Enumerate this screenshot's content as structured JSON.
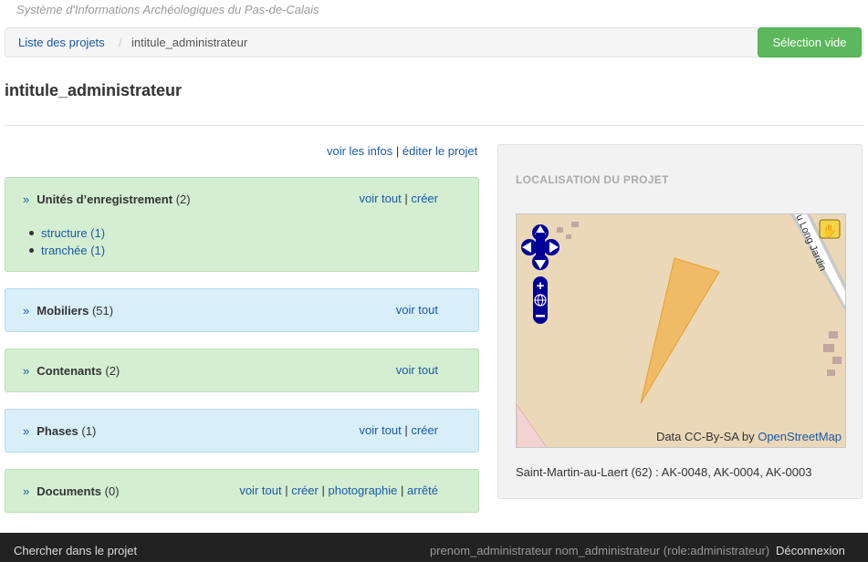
{
  "site": {
    "title": "Système d'Informations Archéologiques du Pas-de-Calais"
  },
  "breadcrumb": {
    "projects_link": "Liste des projets",
    "separator": "/",
    "current": "intitule_administrateur"
  },
  "header": {
    "selection_button": "Sélection vide"
  },
  "page": {
    "title": "intitule_administrateur"
  },
  "project_links": {
    "view_info": "voir les infos",
    "separator": "|",
    "edit": "éditer le projet"
  },
  "panels": {
    "unites": {
      "chevron": "»",
      "title": "Unités d’enregistrement",
      "count": "(2)",
      "view_all": "voir tout",
      "sep": "|",
      "create": "créer",
      "items": [
        {
          "label": "structure (1)"
        },
        {
          "label": "tranchée (1)"
        }
      ]
    },
    "mobiliers": {
      "chevron": "»",
      "title": "Mobiliers",
      "count": "(51)",
      "view_all": "voir tout"
    },
    "contenants": {
      "chevron": "»",
      "title": "Contenants",
      "count": "(2)",
      "view_all": "voir tout"
    },
    "phases": {
      "chevron": "»",
      "title": "Phases",
      "count": "(1)",
      "view_all": "voir tout",
      "sep": "|",
      "create": "créer"
    },
    "documents": {
      "chevron": "»",
      "title": "Documents",
      "count": "(0)",
      "view_all": "voir tout",
      "sep1": "|",
      "create": "créer",
      "sep2": "|",
      "photo": "photographie",
      "sep3": "|",
      "arrete": "arrêté"
    }
  },
  "map": {
    "heading": "LOCALISATION DU PROJET",
    "street_label": "u Long Jardin",
    "attribution_prefix": "Data CC-By-SA by",
    "attribution_link": "OpenStreetMap",
    "caption": "Saint-Martin-au-Laert (62) : AK-0048, AK-0004, AK-0003",
    "colors": {
      "background": "#ebd8b8",
      "parcel_fill": "#f0bb66",
      "parcel_stroke": "#e8a63a",
      "controls": "#000099"
    }
  },
  "footer": {
    "search_link": "Chercher dans le projet",
    "user": "prenom_administrateur nom_administrateur (role:administrateur)",
    "logout": "Déconnexion"
  },
  "colors": {
    "green_panel": "#d4eed2",
    "blue_panel": "#d8eef8",
    "button_green": "#5cb85c",
    "link": "#1a5aa5",
    "footer": "#222222"
  }
}
